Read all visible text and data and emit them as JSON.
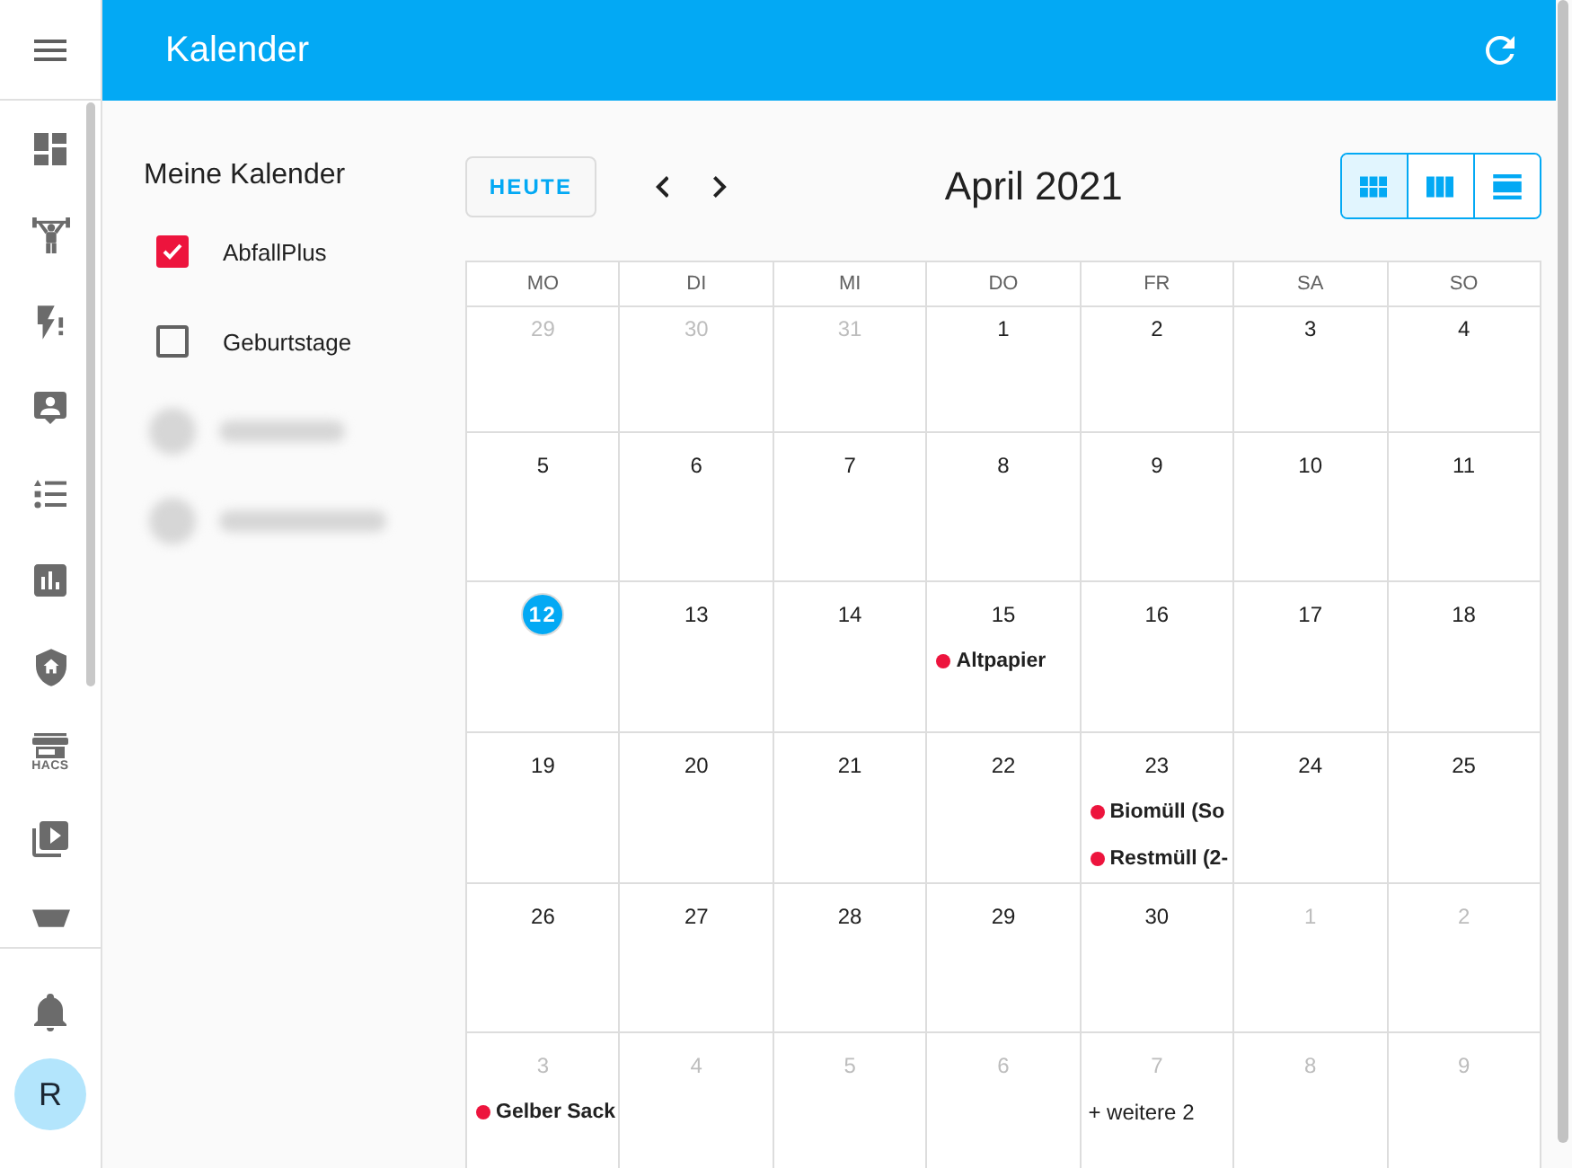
{
  "sidebar": {
    "store_caption": "HACS",
    "avatar_initial": "R"
  },
  "topbar": {
    "title": "Kalender"
  },
  "calendars_panel": {
    "heading": "Meine Kalender",
    "calendars": [
      {
        "kind": "entry",
        "label": "AbfallPlus",
        "checked": true,
        "color": "#ed143d"
      },
      {
        "kind": "entry",
        "label": "Geburtstage",
        "checked": false
      },
      {
        "kind": "blurred"
      },
      {
        "kind": "blurred"
      }
    ]
  },
  "toolbar": {
    "today_button": "HEUTE",
    "title": "April 2021",
    "views": [
      {
        "kind": "month",
        "selected": true
      },
      {
        "kind": "week",
        "selected": false
      },
      {
        "kind": "list",
        "selected": false
      }
    ]
  },
  "grid": {
    "weekdays": [
      "MO",
      "DI",
      "MI",
      "DO",
      "FR",
      "SA",
      "SO"
    ],
    "weeks": [
      [
        {
          "day": "29",
          "outside": true,
          "today": false
        },
        {
          "day": "30",
          "outside": true,
          "today": false
        },
        {
          "day": "31",
          "outside": true,
          "today": false
        },
        {
          "day": "1",
          "outside": false,
          "today": false
        },
        {
          "day": "2",
          "outside": false,
          "today": false
        },
        {
          "day": "3",
          "outside": false,
          "today": false
        },
        {
          "day": "4",
          "outside": false,
          "today": false
        }
      ],
      [
        {
          "day": "5",
          "outside": false,
          "today": false
        },
        {
          "day": "6",
          "outside": false,
          "today": false
        },
        {
          "day": "7",
          "outside": false,
          "today": false
        },
        {
          "day": "8",
          "outside": false,
          "today": false
        },
        {
          "day": "9",
          "outside": false,
          "today": false
        },
        {
          "day": "10",
          "outside": false,
          "today": false
        },
        {
          "day": "11",
          "outside": false,
          "today": false
        }
      ],
      [
        {
          "day": "12",
          "outside": false,
          "today": true
        },
        {
          "day": "13",
          "outside": false,
          "today": false
        },
        {
          "day": "14",
          "outside": false,
          "today": false
        },
        {
          "day": "15",
          "outside": false,
          "today": false,
          "events": [
            {
              "title": "Altpapier",
              "color": "#ed143d"
            }
          ]
        },
        {
          "day": "16",
          "outside": false,
          "today": false
        },
        {
          "day": "17",
          "outside": false,
          "today": false
        },
        {
          "day": "18",
          "outside": false,
          "today": false
        }
      ],
      [
        {
          "day": "19",
          "outside": false,
          "today": false
        },
        {
          "day": "20",
          "outside": false,
          "today": false
        },
        {
          "day": "21",
          "outside": false,
          "today": false
        },
        {
          "day": "22",
          "outside": false,
          "today": false
        },
        {
          "day": "23",
          "outside": false,
          "today": false,
          "events": [
            {
              "title": "Biomüll (So",
              "color": "#ed143d"
            },
            {
              "title": "Restmüll (2-",
              "color": "#ed143d"
            }
          ]
        },
        {
          "day": "24",
          "outside": false,
          "today": false
        },
        {
          "day": "25",
          "outside": false,
          "today": false
        }
      ],
      [
        {
          "day": "26",
          "outside": false,
          "today": false
        },
        {
          "day": "27",
          "outside": false,
          "today": false
        },
        {
          "day": "28",
          "outside": false,
          "today": false
        },
        {
          "day": "29",
          "outside": false,
          "today": false
        },
        {
          "day": "30",
          "outside": false,
          "today": false
        },
        {
          "day": "1",
          "outside": true,
          "today": false
        },
        {
          "day": "2",
          "outside": true,
          "today": false
        }
      ],
      [
        {
          "day": "3",
          "outside": true,
          "today": false,
          "events": [
            {
              "title": "Gelber Sack",
              "color": "#ed143d"
            }
          ]
        },
        {
          "day": "4",
          "outside": true,
          "today": false
        },
        {
          "day": "5",
          "outside": true,
          "today": false
        },
        {
          "day": "6",
          "outside": true,
          "today": false
        },
        {
          "day": "7",
          "outside": true,
          "today": false,
          "more": "+ weitere 2"
        },
        {
          "day": "8",
          "outside": true,
          "today": false
        },
        {
          "day": "9",
          "outside": true,
          "today": false
        }
      ]
    ]
  }
}
